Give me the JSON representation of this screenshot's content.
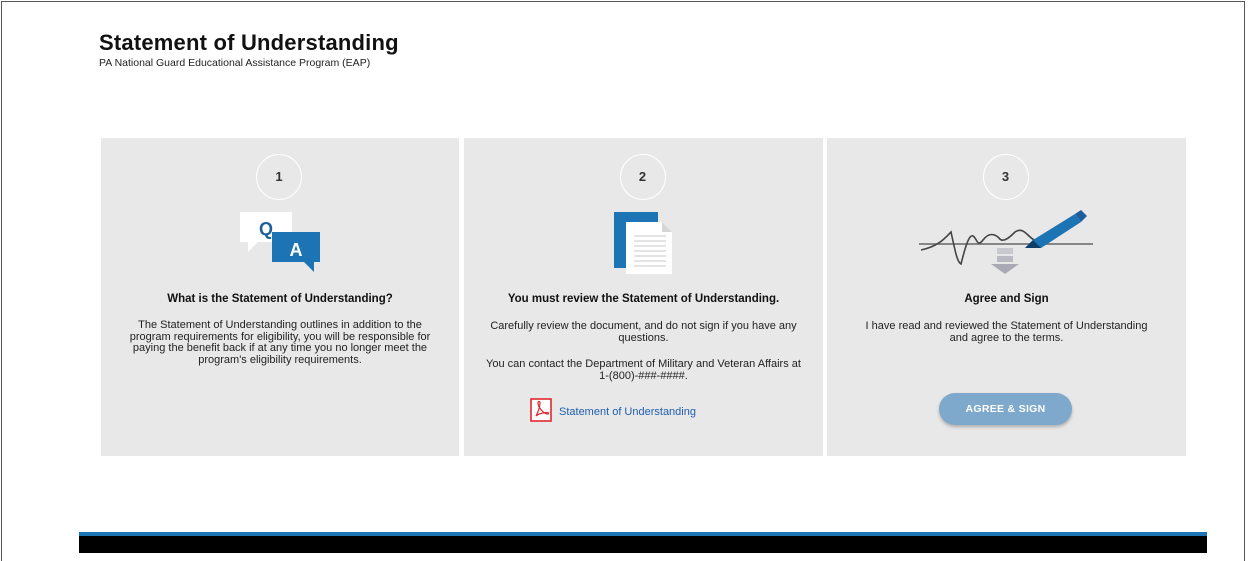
{
  "header": {
    "title": "Statement of Understanding",
    "subtitle": "PA National Guard Educational Assistance Program (EAP)"
  },
  "panels": [
    {
      "step": "1",
      "icon": "qa-chat-icon",
      "heading": "What is the Statement of Understanding?",
      "body": "The Statement of Understanding outlines in addition to the program requirements for eligibility, you will be responsible for paying the benefit back if at any time you no longer meet the program's eligibility requirements."
    },
    {
      "step": "2",
      "icon": "document-icon",
      "heading": "You must review the Statement of Understanding.",
      "body": "Carefully review the document, and do not sign if you have any questions.",
      "body2": "You can contact the Department of Military and Veteran Affairs at 1-(800)-###-####.",
      "link_label": "Statement of Understanding",
      "link_icon": "pdf-icon"
    },
    {
      "step": "3",
      "icon": "signature-pen-icon",
      "heading": "Agree and Sign",
      "body": "I have read and reviewed the Statement of Understanding and agree to the terms.",
      "button_label": "AGREE & SIGN"
    }
  ],
  "colors": {
    "panel_bg": "#e8e8e9",
    "accent_blue": "#1c74b4",
    "button_bg": "#7ea8cc",
    "link": "#1f5fae",
    "pdf_red": "#e0282e",
    "footer": "#000000"
  }
}
